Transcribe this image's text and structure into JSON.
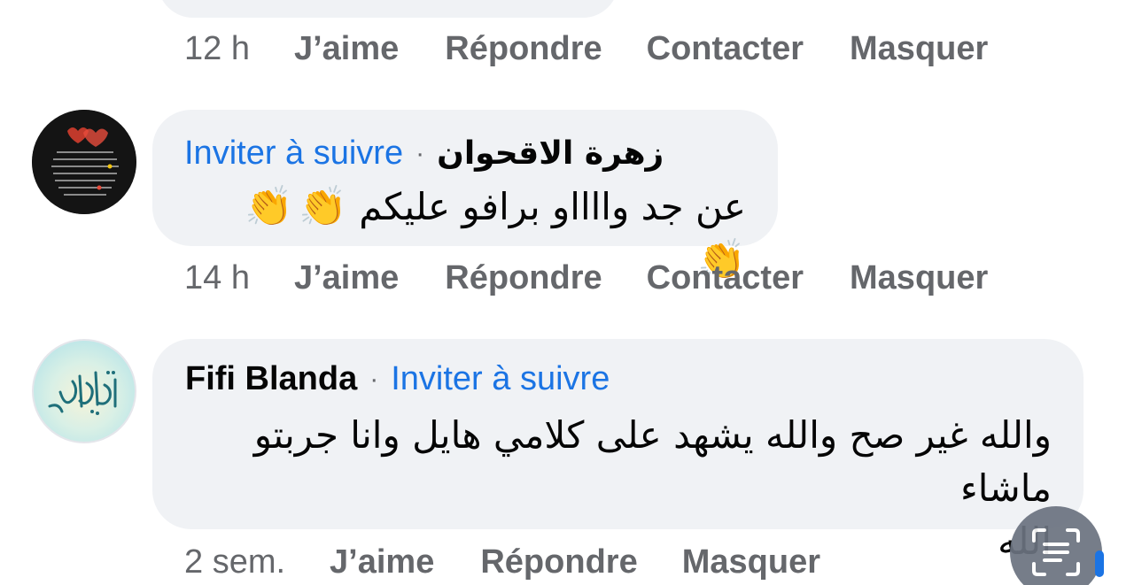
{
  "comments": [
    {
      "time": "12 h",
      "actions": [
        "J’aime",
        "Répondre",
        "Contacter",
        "Masquer"
      ]
    },
    {
      "author": "زهرة  الاقحوان",
      "follow_link": "Inviter à suivre",
      "separator": "·",
      "text": "عن جد وااااو برافو عليكم",
      "emoji": [
        "👏",
        "👏",
        "👏"
      ],
      "time": "14 h",
      "actions": [
        "J’aime",
        "Répondre",
        "Contacter",
        "Masquer"
      ]
    },
    {
      "author": "Fifi Blanda",
      "follow_link": "Inviter à suivre",
      "separator": "·",
      "text_line1": "والله غير صح والله يشهد على كلامي هايل وانا جربتو ماشاء",
      "text_line2": "الله",
      "time": "2 sem.",
      "actions": [
        "J’aime",
        "Répondre",
        "Masquer"
      ]
    }
  ],
  "colors": {
    "bubble": "#f0f2f5",
    "link": "#1b74e4",
    "meta": "#65676b",
    "text": "#050505"
  },
  "icons": {
    "scan": "text-scan-icon"
  }
}
